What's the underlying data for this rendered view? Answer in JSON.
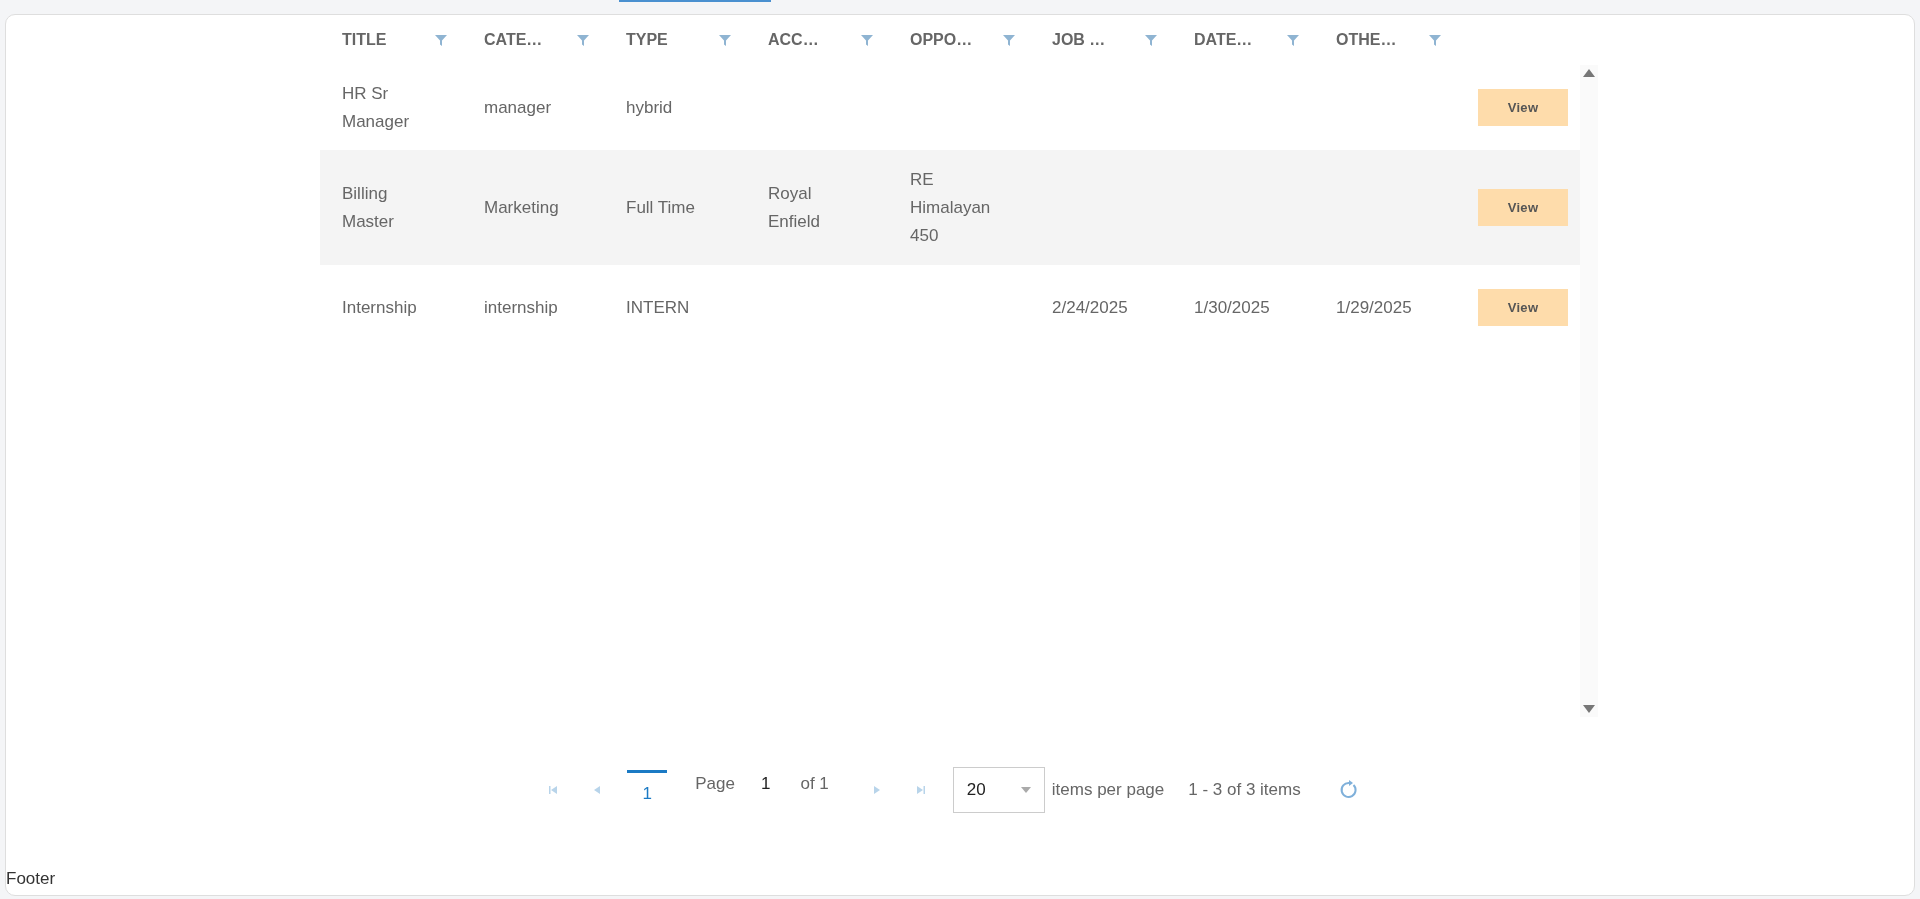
{
  "columns": [
    {
      "label": "TITLE"
    },
    {
      "label": "CATE…"
    },
    {
      "label": "TYPE"
    },
    {
      "label": "ACC…"
    },
    {
      "label": "OPPO…"
    },
    {
      "label": "JOB …"
    },
    {
      "label": "DATE…"
    },
    {
      "label": "OTHE…"
    }
  ],
  "rows": [
    {
      "cells": {
        "column_1": "HR Sr Manager",
        "column_2": "manager",
        "column_3": "hybrid"
      },
      "action": "View"
    },
    {
      "cells": {
        "column_1": "Billing Master",
        "column_2": "Marketing",
        "column_3": "Full Time",
        "column_4": "Royal Enfield",
        "column_5": "RE Himalayan 450"
      },
      "action": "View"
    },
    {
      "cells": {
        "column_1": "Internship",
        "column_2": "internship",
        "column_3": "INTERN",
        "column_6": "2/24/2025",
        "column_7": "1/30/2025",
        "column_8": "1/29/2025"
      },
      "action": "View"
    }
  ],
  "pager": {
    "pages": [
      {
        "label": "1",
        "selected": true
      }
    ],
    "page_label": "Page",
    "page_value": "1",
    "of_label": "of 1",
    "nav_disabled": true,
    "page_size": "20",
    "page_size_label": "items per page",
    "summary": "1 - 3 of 3 items"
  },
  "footer": "Footer"
}
